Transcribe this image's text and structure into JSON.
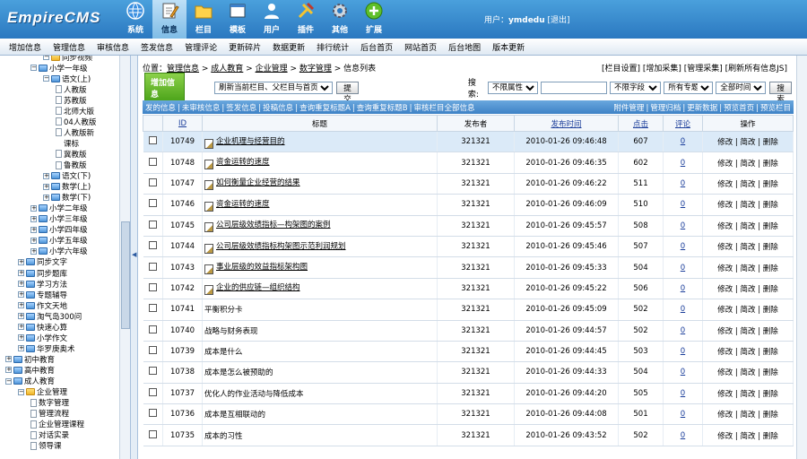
{
  "header": {
    "logo": "EmpireCMS",
    "nav": [
      {
        "label": "系统",
        "icon": "globe-icon"
      },
      {
        "label": "信息",
        "icon": "pencil-note-icon",
        "active": true
      },
      {
        "label": "栏目",
        "icon": "folder-icon"
      },
      {
        "label": "模板",
        "icon": "window-icon"
      },
      {
        "label": "用户",
        "icon": "user-icon"
      },
      {
        "label": "插件",
        "icon": "tools-icon"
      },
      {
        "label": "其他",
        "icon": "gear-icon"
      },
      {
        "label": "扩展",
        "icon": "plus-circle-icon"
      }
    ],
    "user_prefix": "用户：",
    "username": "ymdedu",
    "logout": "[退出]"
  },
  "submenu": [
    "增加信息",
    "管理信息",
    "审核信息",
    "签发信息",
    "管理评论",
    "更新碎片",
    "数据更新",
    "排行统计",
    "后台首页",
    "网站首页",
    "后台地图",
    "版本更新"
  ],
  "tree": [
    {
      "label": "同步视频",
      "indent": 3,
      "toggle": "−",
      "folder": "yellow"
    },
    {
      "label": "小学一年级",
      "indent": 2,
      "toggle": "−",
      "folder": "blue"
    },
    {
      "label": "语文(上)",
      "indent": 3,
      "toggle": "−",
      "folder": "blue"
    },
    {
      "label": "人教版",
      "indent": 4,
      "doc": true
    },
    {
      "label": "苏教版",
      "indent": 4,
      "doc": true
    },
    {
      "label": "北师大版",
      "indent": 4,
      "doc": true
    },
    {
      "label": "04人教版",
      "indent": 4,
      "doc": true
    },
    {
      "label": "人教版新",
      "indent": 4,
      "doc": true
    },
    {
      "label": "课标",
      "indent": 4,
      "cont": true
    },
    {
      "label": "冀教版",
      "indent": 4,
      "doc": true
    },
    {
      "label": "鲁教版",
      "indent": 4,
      "doc": true
    },
    {
      "label": "语文(下)",
      "indent": 3,
      "toggle": "+",
      "folder": "blue"
    },
    {
      "label": "数学(上)",
      "indent": 3,
      "toggle": "+",
      "folder": "blue"
    },
    {
      "label": "数学(下)",
      "indent": 3,
      "toggle": "+",
      "folder": "blue"
    },
    {
      "label": "小学二年级",
      "indent": 2,
      "toggle": "+",
      "folder": "blue"
    },
    {
      "label": "小学三年级",
      "indent": 2,
      "toggle": "+",
      "folder": "blue"
    },
    {
      "label": "小学四年级",
      "indent": 2,
      "toggle": "+",
      "folder": "blue"
    },
    {
      "label": "小学五年级",
      "indent": 2,
      "toggle": "+",
      "folder": "blue"
    },
    {
      "label": "小学六年级",
      "indent": 2,
      "toggle": "+",
      "folder": "blue"
    },
    {
      "label": "同步文字",
      "indent": 1,
      "toggle": "+",
      "folder": "blue"
    },
    {
      "label": "同步题库",
      "indent": 1,
      "toggle": "+",
      "folder": "blue"
    },
    {
      "label": "学习方法",
      "indent": 1,
      "toggle": "+",
      "folder": "blue"
    },
    {
      "label": "专题辅导",
      "indent": 1,
      "toggle": "+",
      "folder": "blue"
    },
    {
      "label": "作文天地",
      "indent": 1,
      "toggle": "+",
      "folder": "blue"
    },
    {
      "label": "淘气岛300问",
      "indent": 1,
      "toggle": "+",
      "folder": "blue"
    },
    {
      "label": "快速心算",
      "indent": 1,
      "toggle": "+",
      "folder": "blue"
    },
    {
      "label": "小学作文",
      "indent": 1,
      "toggle": "+",
      "folder": "blue"
    },
    {
      "label": "华罗庚奥术",
      "indent": 1,
      "toggle": "+",
      "folder": "blue"
    },
    {
      "label": "初中教育",
      "indent": 0,
      "toggle": "+",
      "folder": "blue"
    },
    {
      "label": "高中教育",
      "indent": 0,
      "toggle": "+",
      "folder": "blue"
    },
    {
      "label": "成人教育",
      "indent": 0,
      "toggle": "−",
      "folder": "blue"
    },
    {
      "label": "企业管理",
      "indent": 1,
      "toggle": "−",
      "folder": "yellow"
    },
    {
      "label": "数字管理",
      "indent": 2,
      "doc": true
    },
    {
      "label": "管理流程",
      "indent": 2,
      "doc": true
    },
    {
      "label": "企业管理课程",
      "indent": 2,
      "doc": true
    },
    {
      "label": "对话实录",
      "indent": 2,
      "doc": true
    },
    {
      "label": "领导课",
      "indent": 2,
      "doc": true
    }
  ],
  "position": {
    "prefix": "位置：",
    "crumbs": [
      "管理信息",
      "成人教育",
      "企业管理",
      "数字管理"
    ],
    "tail": "信息列表",
    "sep": " > "
  },
  "top_links": "[栏目设置] [增加采集] [管理采集] [刷新所有信息JS]",
  "toolbar": {
    "add_button": "增加信息",
    "refresh_select": "刷新当前栏目、父栏目与首页",
    "submit": "提交",
    "search_label": "搜索:",
    "attr_select": "不限属性",
    "search_value": "",
    "field_select": "不限字段",
    "special_select": "所有专题",
    "time_select": "全部时间",
    "search_button": "搜索"
  },
  "filters_left": [
    "发的信息",
    "未审核信息",
    "签发信息",
    "投稿信息",
    "查询重复标题A",
    "查询重复标题B",
    "审核栏目全部信息"
  ],
  "filters_right": [
    "附件管理",
    "管理归档",
    "更新数据",
    "预览首页",
    "预览栏目"
  ],
  "columns": {
    "id": "ID",
    "title": "标题",
    "publisher": "发布者",
    "time": "发布时间",
    "clicks": "点击",
    "comments": "评论",
    "ops": "操作"
  },
  "ops": {
    "edit": "修改",
    "draft": "简改",
    "delete": "删除",
    "sep": " | "
  },
  "rows": [
    {
      "id": "10749",
      "title": "企业机理与经营目的",
      "img": true,
      "pub": "321321",
      "time": "2010-01-26 09:46:48",
      "clicks": "607",
      "comments": "0",
      "hl": true
    },
    {
      "id": "10748",
      "title": "资金运转的速度",
      "img": true,
      "pub": "321321",
      "time": "2010-01-26 09:46:35",
      "clicks": "602",
      "comments": "0"
    },
    {
      "id": "10747",
      "title": "如何衡量企业经营的结果",
      "img": true,
      "pub": "321321",
      "time": "2010-01-26 09:46:22",
      "clicks": "511",
      "comments": "0"
    },
    {
      "id": "10746",
      "title": "资金运转的速度",
      "img": true,
      "pub": "321321",
      "time": "2010-01-26 09:46:09",
      "clicks": "510",
      "comments": "0"
    },
    {
      "id": "10745",
      "title": "公司层级效绩指标—构架图的案例",
      "img": true,
      "pub": "321321",
      "time": "2010-01-26 09:45:57",
      "clicks": "508",
      "comments": "0"
    },
    {
      "id": "10744",
      "title": "公司层级效绩指标构架图示范利润规划",
      "img": true,
      "pub": "321321",
      "time": "2010-01-26 09:45:46",
      "clicks": "507",
      "comments": "0"
    },
    {
      "id": "10743",
      "title": "事业层级的效益指标架构图",
      "img": true,
      "pub": "321321",
      "time": "2010-01-26 09:45:33",
      "clicks": "504",
      "comments": "0"
    },
    {
      "id": "10742",
      "title": "企业的供应链—组织结构",
      "img": true,
      "pub": "321321",
      "time": "2010-01-26 09:45:22",
      "clicks": "506",
      "comments": "0"
    },
    {
      "id": "10741",
      "title": "平衡积分卡",
      "img": false,
      "pub": "321321",
      "time": "2010-01-26 09:45:09",
      "clicks": "502",
      "comments": "0"
    },
    {
      "id": "10740",
      "title": "战略与财务表现",
      "img": false,
      "pub": "321321",
      "time": "2010-01-26 09:44:57",
      "clicks": "502",
      "comments": "0"
    },
    {
      "id": "10739",
      "title": "成本是什么",
      "img": false,
      "pub": "321321",
      "time": "2010-01-26 09:44:45",
      "clicks": "503",
      "comments": "0"
    },
    {
      "id": "10738",
      "title": "成本是怎么被预助的",
      "img": false,
      "pub": "321321",
      "time": "2010-01-26 09:44:33",
      "clicks": "504",
      "comments": "0"
    },
    {
      "id": "10737",
      "title": "优化人的作业活动与降低成本",
      "img": false,
      "pub": "321321",
      "time": "2010-01-26 09:44:20",
      "clicks": "505",
      "comments": "0"
    },
    {
      "id": "10736",
      "title": "成本是互相联动的",
      "img": false,
      "pub": "321321",
      "time": "2010-01-26 09:44:08",
      "clicks": "501",
      "comments": "0"
    },
    {
      "id": "10735",
      "title": "成本的习性",
      "img": false,
      "pub": "321321",
      "time": "2010-01-26 09:43:52",
      "clicks": "502",
      "comments": "0"
    }
  ]
}
